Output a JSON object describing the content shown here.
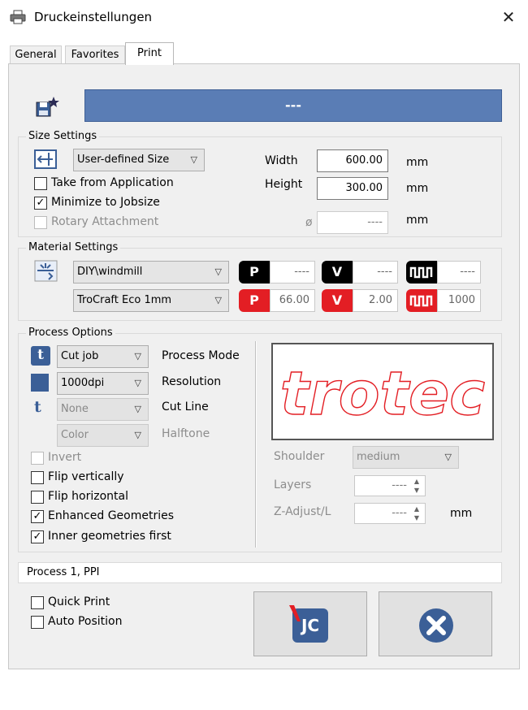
{
  "window": {
    "title": "Druckeinstellungen",
    "close_glyph": "✕"
  },
  "tabs": [
    {
      "label": "General"
    },
    {
      "label": "Favorites"
    },
    {
      "label": "Print"
    }
  ],
  "job": {
    "name": "---"
  },
  "size_settings": {
    "title": "Size Settings",
    "size_mode": "User-defined Size",
    "take_from_app": {
      "label": "Take from Application",
      "checked": false
    },
    "minimize_jobsize": {
      "label": "Minimize to Jobsize",
      "checked": true
    },
    "rotary": {
      "label": "Rotary Attachment",
      "checked": false,
      "disabled": true
    },
    "width": {
      "label": "Width",
      "value": "600.00",
      "unit": "mm"
    },
    "height": {
      "label": "Height",
      "value": "300.00",
      "unit": "mm"
    },
    "diameter": {
      "symbol": "ø",
      "value": "----",
      "unit": "mm"
    }
  },
  "material_settings": {
    "title": "Material Settings",
    "material_group": "DIY\\windmill",
    "material": "TroCraft Eco 1mm",
    "row1": {
      "power": "----",
      "velocity": "----",
      "frequency": "----"
    },
    "row2": {
      "power": "66.00",
      "velocity": "2.00",
      "frequency": "1000"
    },
    "badge_p": "P",
    "badge_v": "V"
  },
  "process_options": {
    "title": "Process Options",
    "process_mode": {
      "value": "Cut job",
      "label": "Process Mode"
    },
    "resolution": {
      "value": "1000dpi",
      "label": "Resolution"
    },
    "cut_line": {
      "value": "None",
      "label": "Cut Line"
    },
    "halftone": {
      "value": "Color",
      "label": "Halftone"
    },
    "cut_icon_glyph": "t",
    "invert": {
      "label": "Invert",
      "checked": false,
      "disabled": true
    },
    "flip_vertically": {
      "label": "Flip vertically",
      "checked": false
    },
    "flip_horizontal": {
      "label": "Flip horizontal",
      "checked": false
    },
    "enhanced_geometries": {
      "label": "Enhanced Geometries",
      "checked": true
    },
    "inner_geometries_first": {
      "label": "Inner geometries first",
      "checked": true
    },
    "preview_text": "trotec",
    "shoulder": {
      "label": "Shoulder",
      "value": "medium"
    },
    "layers": {
      "label": "Layers",
      "value": "----"
    },
    "z_adjust": {
      "label": "Z-Adjust/L",
      "value": "----",
      "unit": "mm"
    }
  },
  "status": {
    "text": "Process 1, PPI"
  },
  "quick_print": {
    "label": "Quick Print",
    "checked": false
  },
  "auto_position": {
    "label": "Auto Position",
    "checked": false
  },
  "buttons": {
    "jc_glyph": "JC"
  },
  "colors": {
    "accent": "#5a7db5",
    "trotec_red": "#e31e24"
  }
}
